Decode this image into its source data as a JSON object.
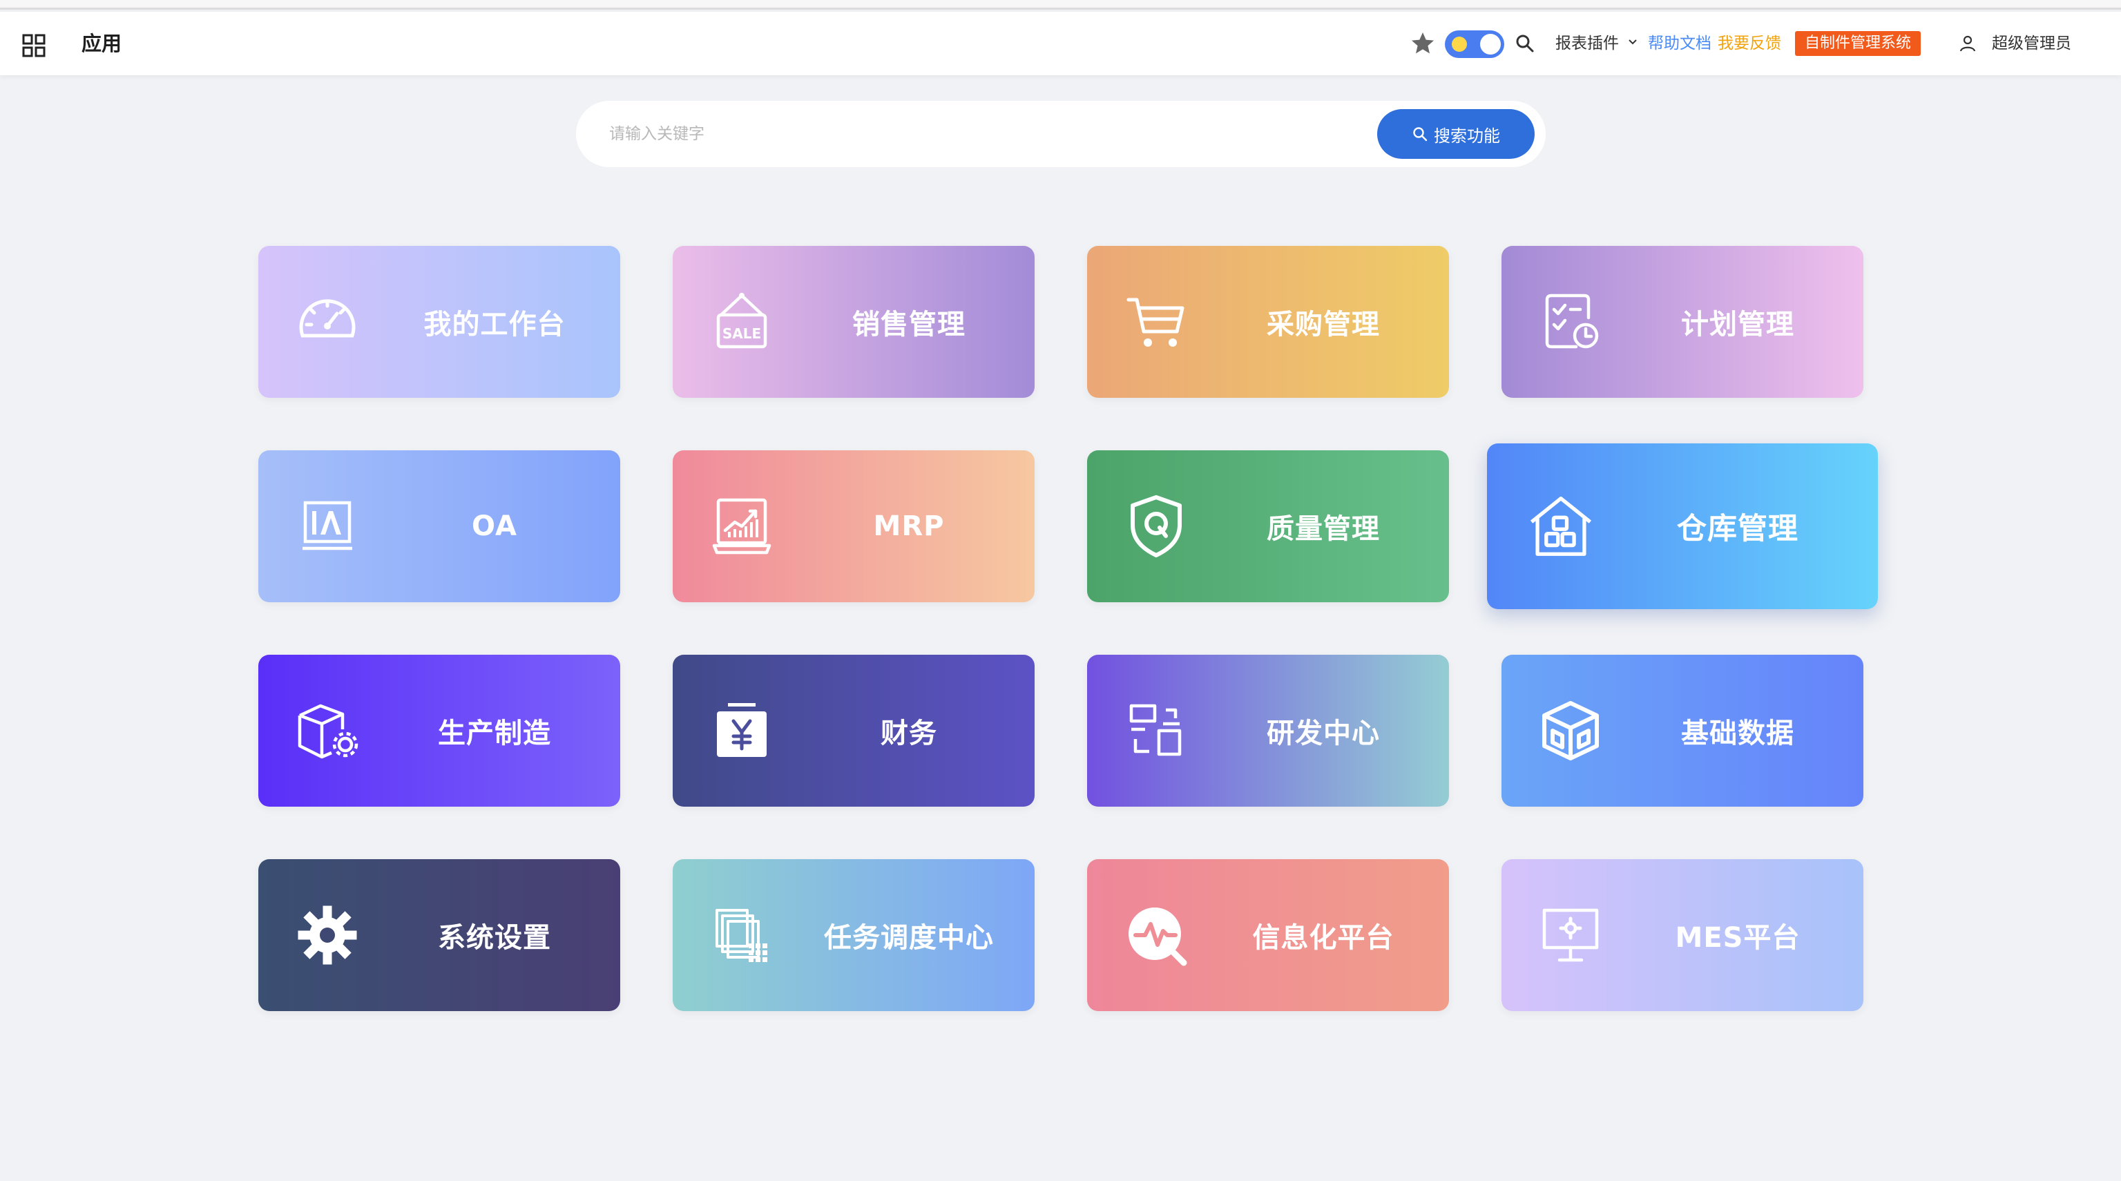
{
  "header": {
    "title": "应用",
    "report_menu": "报表插件",
    "help": "帮助文档",
    "feedback": "我要反馈",
    "custom_system": "自制件管理系统",
    "user": "超级管理员"
  },
  "search": {
    "placeholder": "请输入关键字",
    "button": "搜索功能"
  },
  "apps": [
    {
      "label": "我的工作台",
      "icon": "dashboard-gauge-icon"
    },
    {
      "label": "销售管理",
      "icon": "sale-tag-icon"
    },
    {
      "label": "采购管理",
      "icon": "shopping-cart-icon"
    },
    {
      "label": "计划管理",
      "icon": "schedule-checklist-icon"
    },
    {
      "label": "OA",
      "icon": "oa-icon"
    },
    {
      "label": "MRP",
      "icon": "chart-laptop-icon"
    },
    {
      "label": "质量管理",
      "icon": "quality-shield-icon"
    },
    {
      "label": "仓库管理",
      "icon": "warehouse-icon"
    },
    {
      "label": "生产制造",
      "icon": "production-box-icon"
    },
    {
      "label": "财务",
      "icon": "finance-yen-icon"
    },
    {
      "label": "研发中心",
      "icon": "rnd-blocks-icon"
    },
    {
      "label": "基础数据",
      "icon": "cube-data-icon"
    },
    {
      "label": "系统设置",
      "icon": "settings-gear-icon"
    },
    {
      "label": "任务调度中心",
      "icon": "task-schedule-icon"
    },
    {
      "label": "信息化平台",
      "icon": "info-platform-icon"
    },
    {
      "label": "MES平台",
      "icon": "mes-monitor-icon"
    }
  ],
  "colors": {
    "accent": "#2f6fdc",
    "custom_button": "#f15a1a",
    "help_link": "#4c8bf5",
    "feedback_link": "#f2a20a"
  }
}
